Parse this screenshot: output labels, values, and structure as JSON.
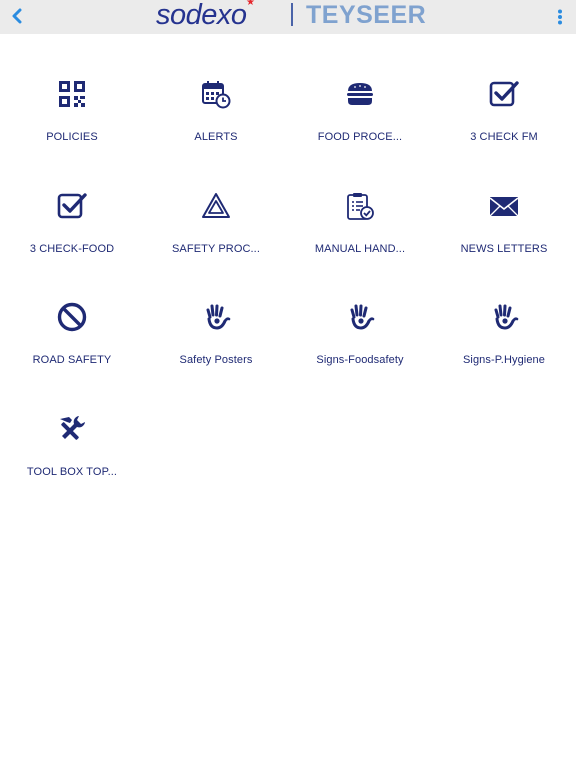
{
  "header": {
    "brand_primary": "sodexo",
    "brand_secondary": "TEYSEER",
    "back_icon": "chevron-left-icon",
    "menu_icon": "more-vertical-icon",
    "accent_color": "#2b8ce0",
    "brand_color": "#25338f"
  },
  "tiles": [
    {
      "label": "POLICIES",
      "icon": "qr-code-icon"
    },
    {
      "label": "ALERTS",
      "icon": "calendar-clock-icon"
    },
    {
      "label": "FOOD PROCE...",
      "icon": "burger-icon"
    },
    {
      "label": "3 CHECK FM",
      "icon": "checkbox-icon"
    },
    {
      "label": "3 CHECK-FOOD",
      "icon": "checkbox-icon"
    },
    {
      "label": "SAFETY PROC...",
      "icon": "warning-triangle-icon"
    },
    {
      "label": "MANUAL HAND...",
      "icon": "clipboard-check-icon"
    },
    {
      "label": "NEWS LETTERS",
      "icon": "envelope-icon"
    },
    {
      "label": "ROAD SAFETY",
      "icon": "no-entry-icon"
    },
    {
      "label": "Safety Posters",
      "icon": "hand-icon"
    },
    {
      "label": "Signs-Foodsafety",
      "icon": "hand-icon"
    },
    {
      "label": "Signs-P.Hygiene",
      "icon": "hand-icon"
    },
    {
      "label": "TOOL BOX TOP...",
      "icon": "tools-icon"
    }
  ],
  "icon_color": "#1f2a74"
}
